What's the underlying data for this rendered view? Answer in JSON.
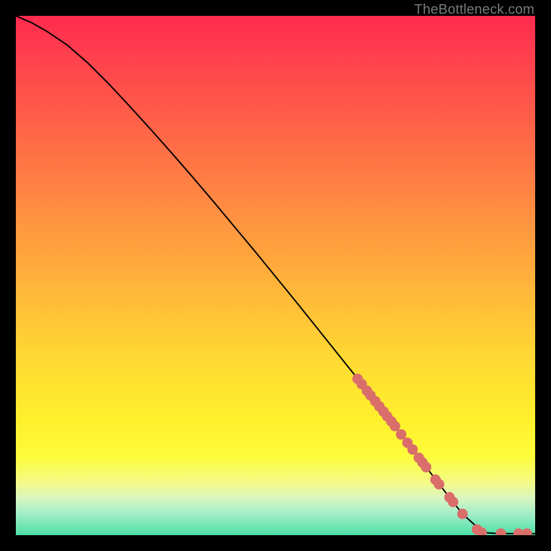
{
  "attribution": "TheBottleneck.com",
  "colors": {
    "background": "#000000",
    "curve": "#000000",
    "dot": "#da6e6a",
    "gradient_top": "#ff2b4e",
    "gradient_mid": "#ffd933",
    "gradient_bottom": "#4de0a6"
  },
  "chart_data": {
    "type": "line",
    "title": "",
    "xlabel": "",
    "ylabel": "",
    "xlim": [
      0,
      100
    ],
    "ylim": [
      0,
      100
    ],
    "curve": {
      "x": [
        0,
        3,
        6,
        10,
        14,
        18,
        22,
        26,
        30,
        34,
        38,
        42,
        46,
        50,
        54,
        58,
        62,
        66,
        70,
        74,
        78,
        82,
        86,
        90,
        93,
        96,
        100
      ],
      "y": [
        100,
        98.7,
        97.0,
        94.3,
        90.8,
        86.8,
        82.5,
        78.1,
        73.6,
        69.0,
        64.3,
        59.5,
        54.7,
        49.8,
        44.9,
        39.9,
        34.9,
        29.9,
        24.8,
        19.6,
        14.4,
        9.2,
        4.1,
        0.5,
        0.3,
        0.3,
        0.3
      ]
    },
    "series": [
      {
        "name": "dots",
        "points": [
          {
            "x": 65.8,
            "y": 30.1
          },
          {
            "x": 66.6,
            "y": 29.1
          },
          {
            "x": 67.6,
            "y": 27.8
          },
          {
            "x": 68.3,
            "y": 26.9
          },
          {
            "x": 69.2,
            "y": 25.8
          },
          {
            "x": 70.0,
            "y": 24.8
          },
          {
            "x": 70.8,
            "y": 23.8
          },
          {
            "x": 71.5,
            "y": 22.9
          },
          {
            "x": 72.3,
            "y": 21.9
          },
          {
            "x": 73.0,
            "y": 21.0
          },
          {
            "x": 74.2,
            "y": 19.4
          },
          {
            "x": 75.4,
            "y": 17.8
          },
          {
            "x": 76.4,
            "y": 16.5
          },
          {
            "x": 77.6,
            "y": 14.9
          },
          {
            "x": 78.3,
            "y": 14.0
          },
          {
            "x": 79.0,
            "y": 13.1
          },
          {
            "x": 80.8,
            "y": 10.7
          },
          {
            "x": 81.5,
            "y": 9.8
          },
          {
            "x": 83.5,
            "y": 7.3
          },
          {
            "x": 84.2,
            "y": 6.4
          },
          {
            "x": 86.0,
            "y": 4.1
          },
          {
            "x": 88.8,
            "y": 1.1
          },
          {
            "x": 89.7,
            "y": 0.5
          },
          {
            "x": 93.4,
            "y": 0.3
          },
          {
            "x": 96.8,
            "y": 0.3
          },
          {
            "x": 98.4,
            "y": 0.3
          }
        ]
      }
    ]
  }
}
